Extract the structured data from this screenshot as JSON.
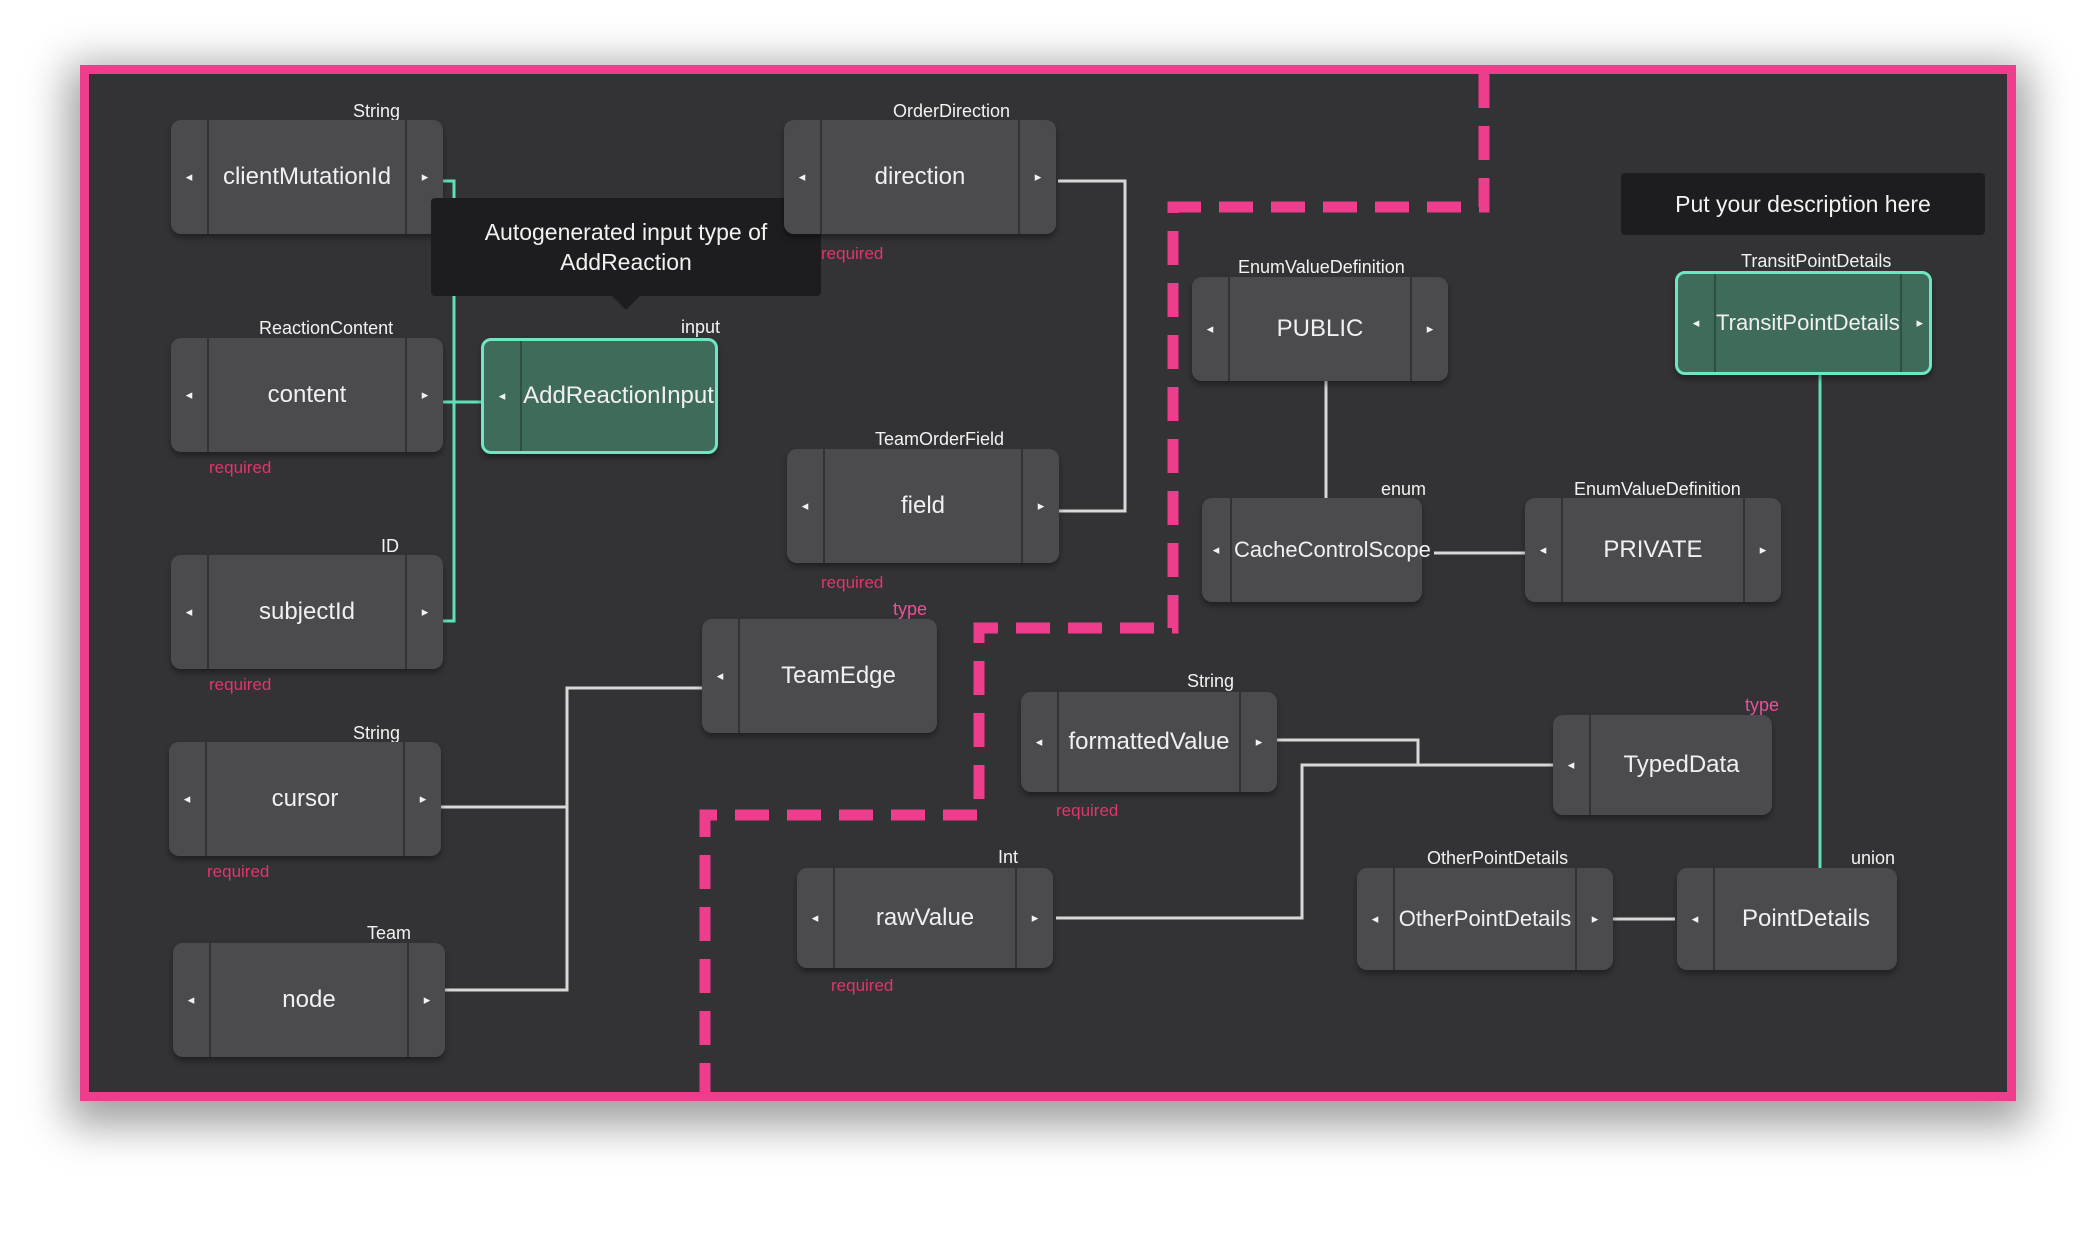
{
  "colors": {
    "frame": "#ee3d8c",
    "canvas": "#333235",
    "node": "#4b4a4e",
    "selected_border": "#6fe6c2",
    "required": "#e0356d",
    "wire": "#d8d8d8"
  },
  "icons": {
    "port_left": "◂",
    "port_right": "▸"
  },
  "tooltips": {
    "add_reaction": {
      "line1": "Autogenerated input type of",
      "line2": "AddReaction"
    },
    "transit": {
      "line1": "Put your description here"
    }
  },
  "nodes": {
    "clientMutationId": {
      "type": "String",
      "label": "clientMutationId"
    },
    "content": {
      "type": "ReactionContent",
      "label": "content",
      "required": "required"
    },
    "subjectId": {
      "type": "ID",
      "label": "subjectId",
      "required": "required"
    },
    "cursor": {
      "type": "String",
      "label": "cursor",
      "required": "required"
    },
    "node": {
      "type": "Team",
      "label": "node"
    },
    "addReactionInput": {
      "type": "input",
      "label": "AddReactionInput"
    },
    "direction": {
      "type": "OrderDirection",
      "label": "direction",
      "required": "required"
    },
    "field": {
      "type": "TeamOrderField",
      "label": "field",
      "required": "required"
    },
    "teamEdge": {
      "type": "type",
      "label": "TeamEdge"
    },
    "public": {
      "type": "EnumValueDefinition",
      "label": "PUBLIC"
    },
    "cacheControlScope": {
      "type": "enum",
      "label": "CacheControlScope"
    },
    "private": {
      "type": "EnumValueDefinition",
      "label": "PRIVATE"
    },
    "transitPointDetails": {
      "type": "TransitPointDetails",
      "label": "TransitPointDetails"
    },
    "formattedValue": {
      "type": "String",
      "label": "formattedValue",
      "required": "required"
    },
    "typedData": {
      "type": "type",
      "label": "TypedData"
    },
    "rawValue": {
      "type": "Int",
      "label": "rawValue",
      "required": "required"
    },
    "otherPointDetails": {
      "type": "OtherPointDetails",
      "label": "OtherPointDetails"
    },
    "pointDetails": {
      "type": "union",
      "label": "PointDetails"
    }
  }
}
